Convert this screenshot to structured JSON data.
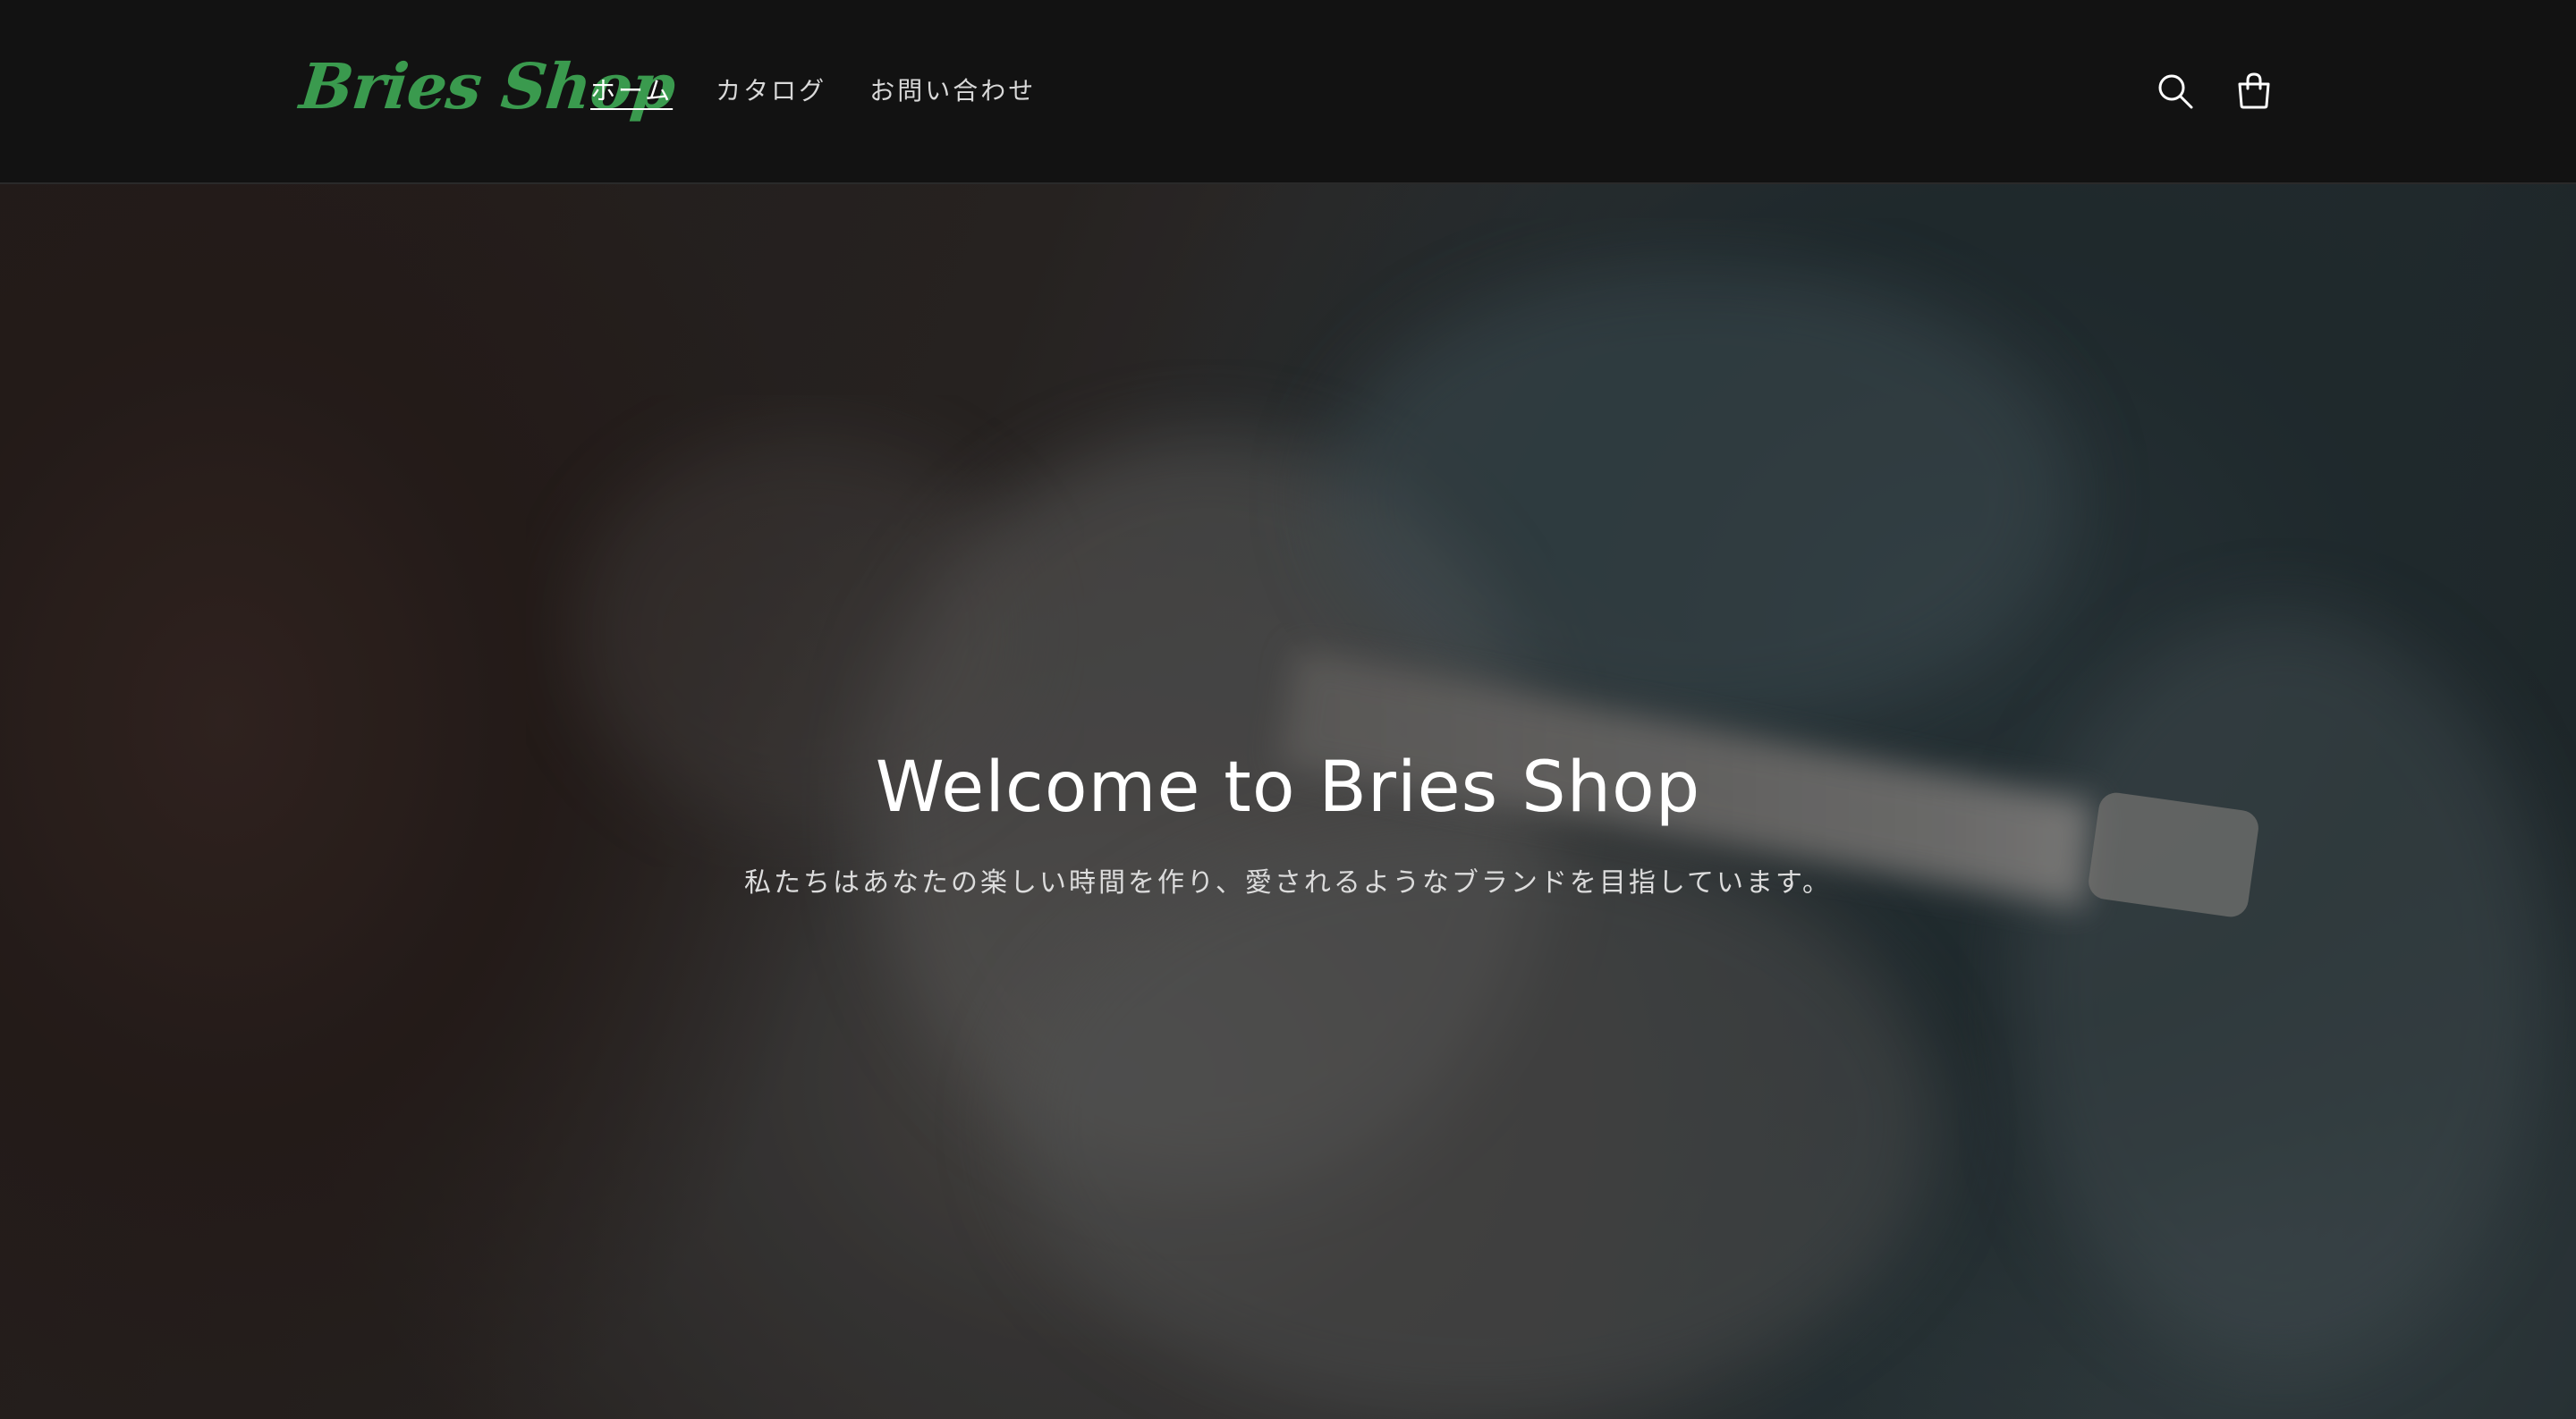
{
  "header": {
    "logo_text": "Bries Shop",
    "nav": [
      {
        "label": "ホーム",
        "active": true
      },
      {
        "label": "カタログ",
        "active": false
      },
      {
        "label": "お問い合わせ",
        "active": false
      }
    ],
    "icons": {
      "search": "search-icon",
      "cart": "cart-icon"
    }
  },
  "hero": {
    "title": "Welcome to Bries Shop",
    "subtitle": "私たちはあなたの楽しい時間を作り、愛されるようなブランドを目指しています。"
  },
  "colors": {
    "header_bg": "#121212",
    "logo": "#3a9a4e",
    "text": "#ffffff"
  }
}
